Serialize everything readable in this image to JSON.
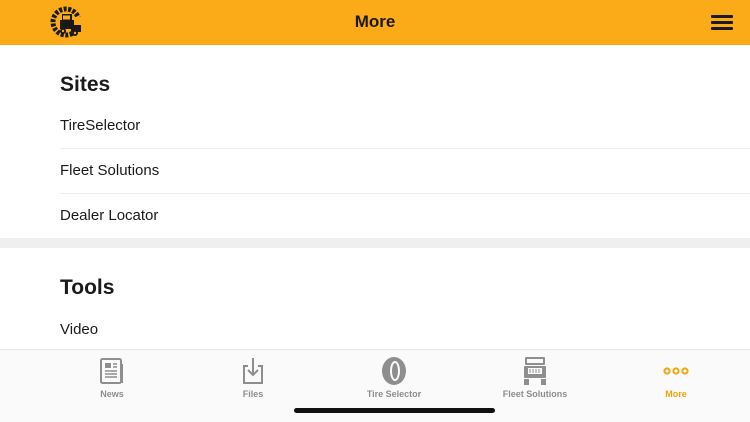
{
  "header": {
    "title": "More",
    "logo_icon": "truck-tire-logo-icon",
    "menu_icon": "hamburger-icon"
  },
  "colors": {
    "header_bg": "#fbab18",
    "accent": "#f0a30a",
    "tab_inactive": "#8e8e8e"
  },
  "sections": [
    {
      "title": "Sites",
      "items": [
        {
          "label": "TireSelector"
        },
        {
          "label": "Fleet Solutions"
        },
        {
          "label": "Dealer Locator"
        }
      ]
    },
    {
      "title": "Tools",
      "items": [
        {
          "label": "Video"
        }
      ]
    }
  ],
  "tabbar": {
    "tabs": [
      {
        "label": "News",
        "icon": "newspaper-icon",
        "active": false
      },
      {
        "label": "Files",
        "icon": "download-icon",
        "active": false
      },
      {
        "label": "Tire Selector",
        "icon": "tire-icon",
        "active": false
      },
      {
        "label": "Fleet Solutions",
        "icon": "semi-truck-icon",
        "active": false
      },
      {
        "label": "More",
        "icon": "ellipsis-icon",
        "active": true
      }
    ]
  }
}
